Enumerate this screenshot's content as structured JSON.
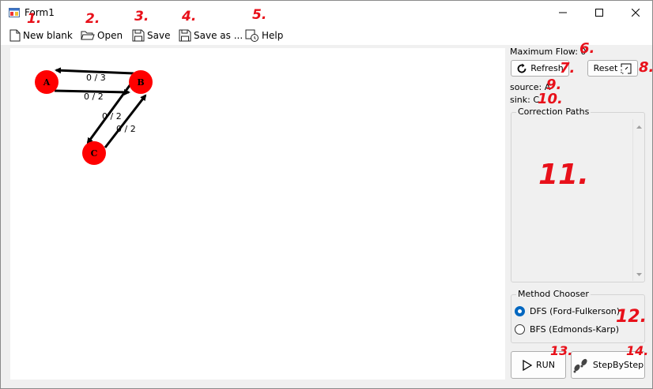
{
  "window": {
    "title": "Form1"
  },
  "toolbar": {
    "new_blank": "New blank",
    "open": "Open",
    "save": "Save",
    "save_as": "Save as ...",
    "help": "Help"
  },
  "graph": {
    "nodes": [
      "A",
      "B",
      "C"
    ],
    "edges": [
      {
        "from": "B",
        "to": "A",
        "label": "0 / 3"
      },
      {
        "from": "A",
        "to": "B",
        "label": "0 / 2"
      },
      {
        "from": "B",
        "to": "C",
        "label": "0 / 2"
      },
      {
        "from": "C",
        "to": "B",
        "label": "0 / 2"
      }
    ]
  },
  "panel": {
    "max_flow": "Maximum Flow: 0",
    "refresh": "Refresh",
    "reset": "Reset",
    "source": "source: A",
    "sink": "sink: C",
    "correction_paths_title": "Correction Paths",
    "method_chooser_title": "Method Chooser",
    "methods": [
      {
        "label": "DFS (Ford-Fulkerson)",
        "checked": true
      },
      {
        "label": "BFS (Edmonds-Karp)",
        "checked": false
      }
    ],
    "run": "RUN",
    "step_by_step": "StepByStep"
  },
  "annotations": [
    "1.",
    "2.",
    "3.",
    "4.",
    "5.",
    "6.",
    "7.",
    "8.",
    "9.",
    "10.",
    "11.",
    "12.",
    "13.",
    "14."
  ],
  "colors": {
    "node_fill": "#ff0000",
    "annotation": "#e8101a",
    "radio_accent": "#0067c0"
  }
}
